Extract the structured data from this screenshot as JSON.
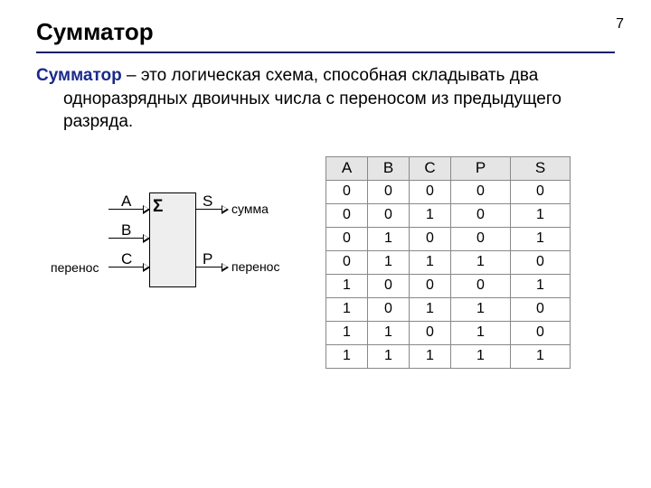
{
  "page_number": "7",
  "title": "Сумматор",
  "definition": {
    "term": "Сумматор",
    "rest": " – это логическая схема, способная складывать два одноразрядных двоичных числа с переносом из предыдущего разряда."
  },
  "diagram": {
    "sigma": "Σ",
    "inputs": {
      "A": "A",
      "B": "B",
      "C": "C"
    },
    "outputs": {
      "S": "S",
      "P": "P"
    },
    "labels": {
      "input_carry": "перенос",
      "output_sum": "сумма",
      "output_carry": "перенос"
    }
  },
  "table": {
    "headers": [
      "A",
      "B",
      "C",
      "P",
      "S"
    ],
    "rows": [
      [
        "0",
        "0",
        "0",
        "0",
        "0"
      ],
      [
        "0",
        "0",
        "1",
        "0",
        "1"
      ],
      [
        "0",
        "1",
        "0",
        "0",
        "1"
      ],
      [
        "0",
        "1",
        "1",
        "1",
        "0"
      ],
      [
        "1",
        "0",
        "0",
        "0",
        "1"
      ],
      [
        "1",
        "0",
        "1",
        "1",
        "0"
      ],
      [
        "1",
        "1",
        "0",
        "1",
        "0"
      ],
      [
        "1",
        "1",
        "1",
        "1",
        "1"
      ]
    ]
  }
}
